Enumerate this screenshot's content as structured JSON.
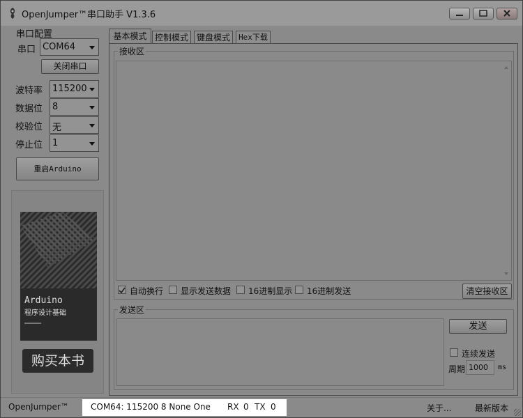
{
  "window": {
    "title": "OpenJumper™串口助手  V1.3.6"
  },
  "serial": {
    "group_label": "串口配置",
    "port_label": "串口",
    "port_value": "COM64",
    "close_button": "关闭串口",
    "baud_label": "波特率",
    "baud_value": "115200",
    "databits_label": "数据位",
    "databits_value": "8",
    "parity_label": "校验位",
    "parity_value": "无",
    "stopbits_label": "停止位",
    "stopbits_value": "1",
    "restart_button": "重启Arduino"
  },
  "book": {
    "title": "Arduino",
    "subtitle": "程序设计基础",
    "buy_button": "购买本书"
  },
  "tabs": [
    {
      "label": "基本模式"
    },
    {
      "label": "控制模式"
    },
    {
      "label": "键盘模式"
    },
    {
      "label": "Hex下载"
    }
  ],
  "receive": {
    "group_label": "接收区",
    "content": "",
    "options": [
      {
        "label": "自动换行",
        "checked": true
      },
      {
        "label": "显示发送数据",
        "checked": false
      },
      {
        "label": "16进制显示",
        "checked": false
      },
      {
        "label": "16进制发送",
        "checked": false
      }
    ],
    "clear_button": "清空接收区"
  },
  "send": {
    "group_label": "发送区",
    "content": "",
    "send_button": "发送",
    "continuous_label": "连续发送",
    "period_label": "周期",
    "period_value": "1000",
    "period_unit": "ms"
  },
  "status": {
    "brand": "OpenJumper™",
    "connection": "COM64: 115200 8 None One",
    "rx_label": "RX",
    "rx_value": "0",
    "tx_label": "TX",
    "tx_value": "0",
    "about": "关于...",
    "latest": "最新版本"
  }
}
